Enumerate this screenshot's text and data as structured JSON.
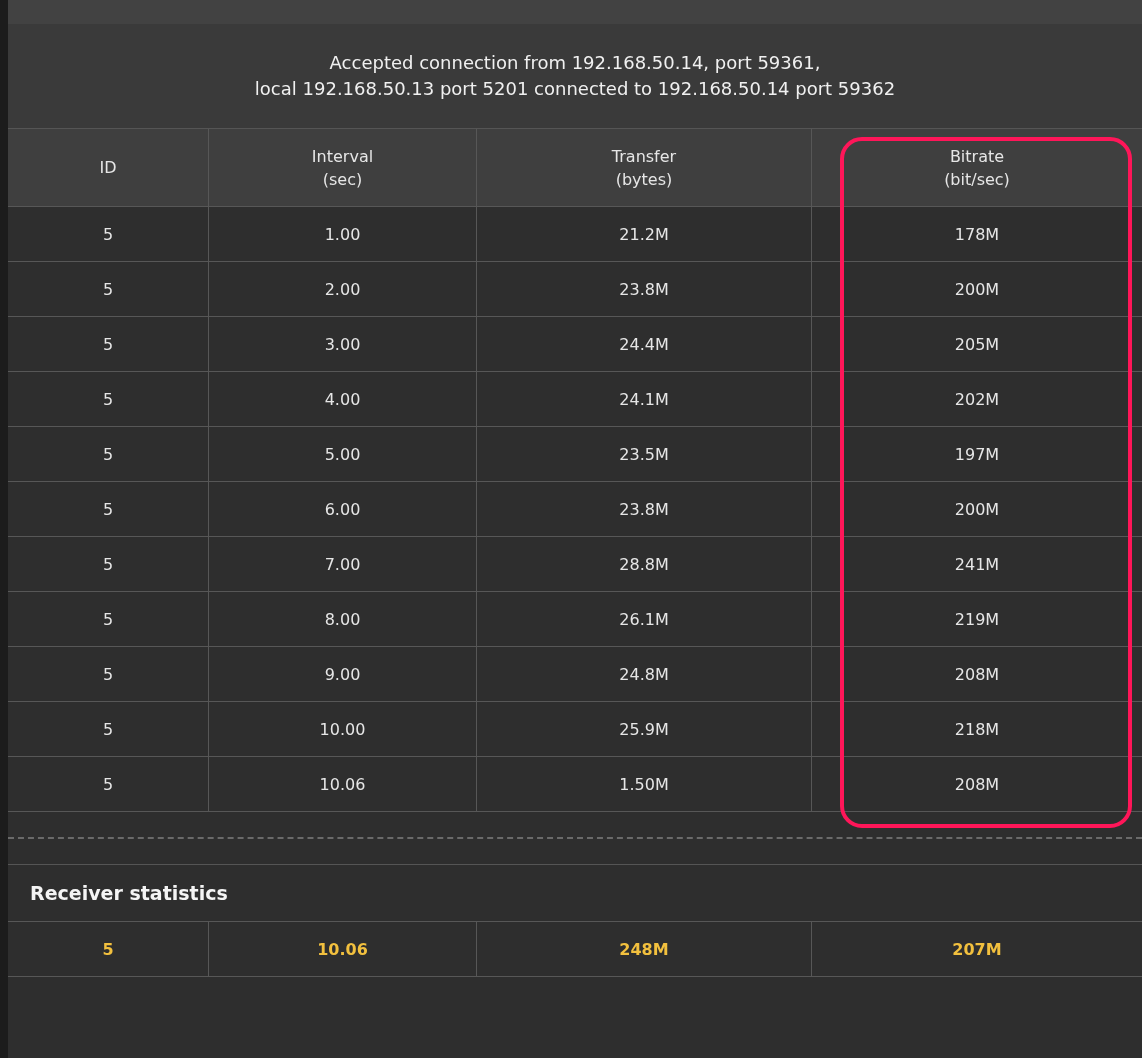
{
  "message": [
    "Accepted connection from 192.168.50.14, port 59361,",
    "local 192.168.50.13 port 5201 connected to 192.168.50.14 port 59362"
  ],
  "table": {
    "columns": [
      {
        "label": "ID",
        "highlighted": false
      },
      {
        "label": "Interval\n(sec)",
        "highlighted": false
      },
      {
        "label": "Transfer\n(bytes)",
        "highlighted": false
      },
      {
        "label": "Bitrate\n(bit/sec)",
        "highlighted": true
      }
    ],
    "rows": [
      [
        "5",
        "1.00",
        "21.2M",
        "178M"
      ],
      [
        "5",
        "2.00",
        "23.8M",
        "200M"
      ],
      [
        "5",
        "3.00",
        "24.4M",
        "205M"
      ],
      [
        "5",
        "4.00",
        "24.1M",
        "202M"
      ],
      [
        "5",
        "5.00",
        "23.5M",
        "197M"
      ],
      [
        "5",
        "6.00",
        "23.8M",
        "200M"
      ],
      [
        "5",
        "7.00",
        "28.8M",
        "241M"
      ],
      [
        "5",
        "8.00",
        "26.1M",
        "219M"
      ],
      [
        "5",
        "9.00",
        "24.8M",
        "208M"
      ],
      [
        "5",
        "10.00",
        "25.9M",
        "218M"
      ],
      [
        "5",
        "10.06",
        "1.50M",
        "208M"
      ]
    ]
  },
  "receiver": {
    "title": "Receiver statistics",
    "row": [
      "5",
      "10.06",
      "248M",
      "207M"
    ]
  }
}
